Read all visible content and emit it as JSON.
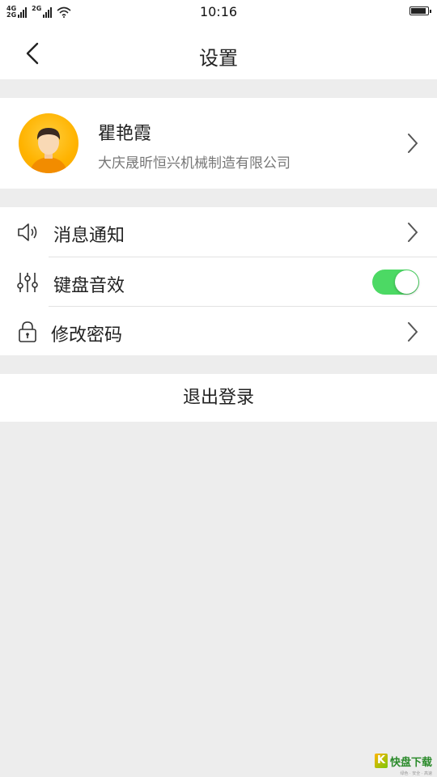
{
  "status_bar": {
    "network_top": "4G",
    "network_bottom": "2G",
    "network_second": "2G",
    "time": "10:16",
    "battery_level": 0.95
  },
  "nav": {
    "title": "设置"
  },
  "profile": {
    "name": "瞿艳霞",
    "company": "大庆晟昕恒兴机械制造有限公司",
    "avatar_bg": "#ffb300"
  },
  "menu": {
    "items": [
      {
        "label": "消息通知",
        "icon": "speaker-icon"
      },
      {
        "label": "键盘音效",
        "icon": "sliders-icon",
        "toggle_on": true
      },
      {
        "label": "修改密码",
        "icon": "lock-icon"
      }
    ]
  },
  "logout": {
    "label": "退出登录"
  },
  "colors": {
    "toggle_on": "#4cd964",
    "background": "#ededed"
  },
  "watermark": {
    "brand_k": "K",
    "brand_text": "快盘下载",
    "brand_sub": "绿色 · 安全 · 高速"
  }
}
